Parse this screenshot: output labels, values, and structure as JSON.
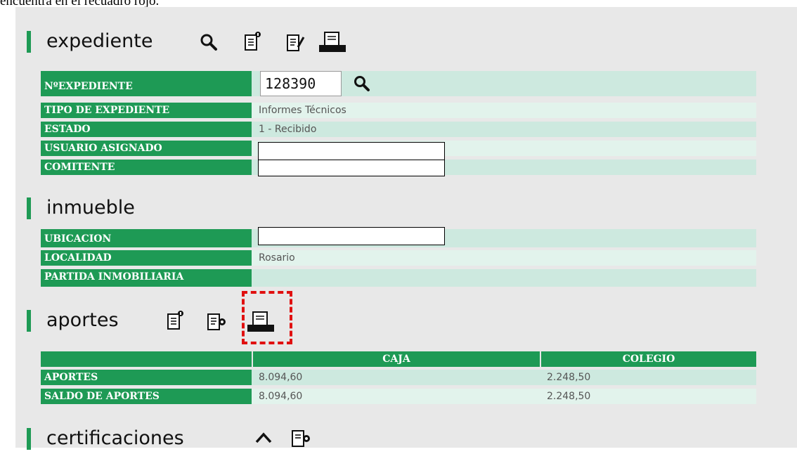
{
  "caption": "encuentra en el recuadro rojo.",
  "colors": {
    "accent": "#1e9a55",
    "row_dark": "#cde9df",
    "row_light": "#e2f3ec",
    "highlight": "#e01010"
  },
  "expediente": {
    "title": "expediente",
    "icons": [
      "search-icon",
      "document-info-icon",
      "document-edit-icon",
      "printer-icon"
    ],
    "rows": [
      {
        "label": "NºEXPEDIENTE",
        "value": "128390"
      },
      {
        "label": "TIPO DE EXPEDIENTE",
        "value": "Informes Técnicos"
      },
      {
        "label": "ESTADO",
        "value": "1 - Recibido"
      },
      {
        "label": "USUARIO ASIGNADO",
        "value": ""
      },
      {
        "label": "COMITENTE",
        "value": ""
      }
    ]
  },
  "inmueble": {
    "title": "inmueble",
    "rows": [
      {
        "label": "UBICACION",
        "value": ""
      },
      {
        "label": "LOCALIDAD",
        "value": "Rosario"
      },
      {
        "label": "PARTIDA INMOBILIARIA",
        "value": ""
      }
    ]
  },
  "aportes": {
    "title": "aportes",
    "icons": [
      "document-info-icon",
      "document-add-icon",
      "printer-icon"
    ],
    "columns": [
      "",
      "CAJA",
      "COLEGIO"
    ],
    "rows": [
      {
        "label": "APORTES",
        "caja": "8.094,60",
        "colegio": "2.248,50"
      },
      {
        "label": "SALDO DE APORTES",
        "caja": "8.094,60",
        "colegio": "2.248,50"
      }
    ]
  },
  "certificaciones": {
    "title": "certificaciones",
    "icons": [
      "chevron-up-icon",
      "document-add-icon"
    ]
  }
}
